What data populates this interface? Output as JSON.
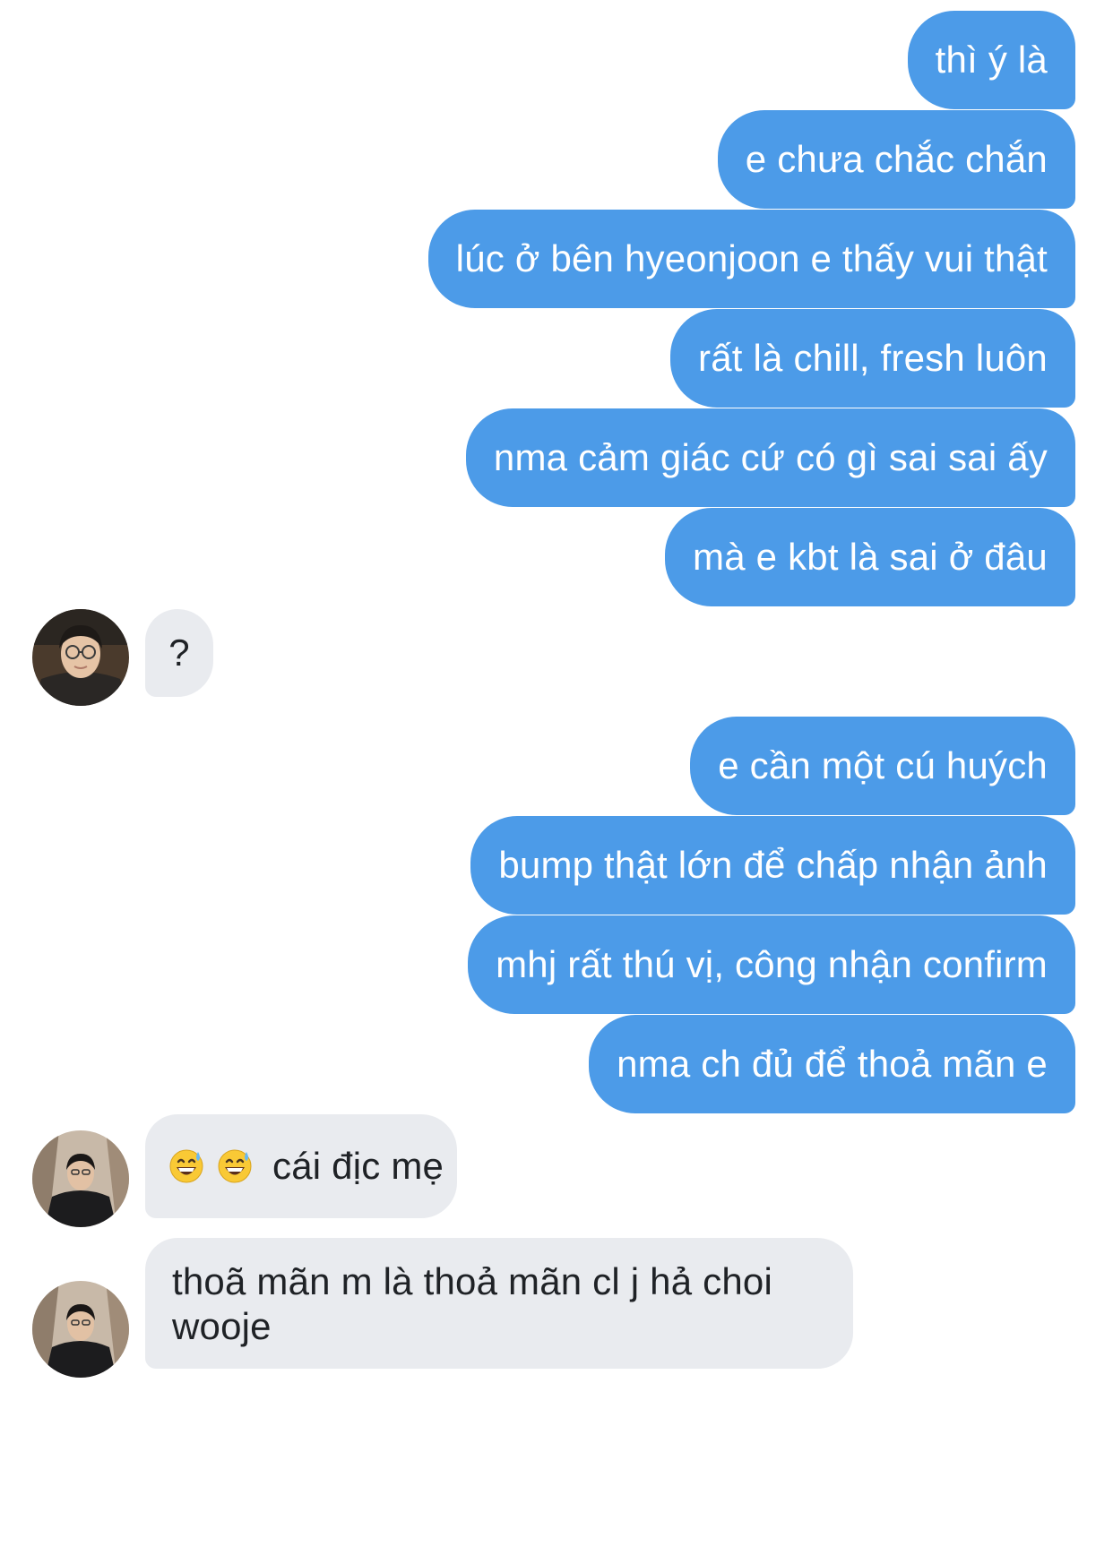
{
  "messages": [
    {
      "from": "me",
      "text": "thì ý là"
    },
    {
      "from": "me",
      "text": "e chưa chắc chắn"
    },
    {
      "from": "me",
      "text": "lúc ở bên hyeonjoon e thấy vui thật"
    },
    {
      "from": "me",
      "text": "rất là chill, fresh luôn"
    },
    {
      "from": "me",
      "text": "nma cảm giác cứ có gì sai sai ấy"
    },
    {
      "from": "me",
      "text": "mà e kbt là sai ở đâu"
    },
    {
      "from": "them",
      "text": "?"
    },
    {
      "from": "me",
      "text": "e cần một cú huých"
    },
    {
      "from": "me",
      "text": "bump thật lớn để chấp nhận ảnh"
    },
    {
      "from": "me",
      "text": "mhj rất thú vị, công nhận confirm"
    },
    {
      "from": "me",
      "text": "nma ch đủ để thoả mãn e"
    },
    {
      "from": "them",
      "emojis": [
        "grinning-sweat-emoji",
        "grinning-sweat-emoji"
      ],
      "text": "cái địc mẹ"
    },
    {
      "from": "them",
      "lines": [
        "thoã mãn m là thoả mãn cl j hả choi",
        "wooje"
      ]
    }
  ],
  "colors": {
    "sent_bubble": "#4c9be8",
    "sent_text": "#ffffff",
    "received_bubble": "#e9ebef",
    "received_text": "#1f2226",
    "background": "#ffffff"
  },
  "icons": {
    "avatar": "contact-avatar-photo",
    "emoji": "grinning-face-with-sweat-emoji"
  }
}
